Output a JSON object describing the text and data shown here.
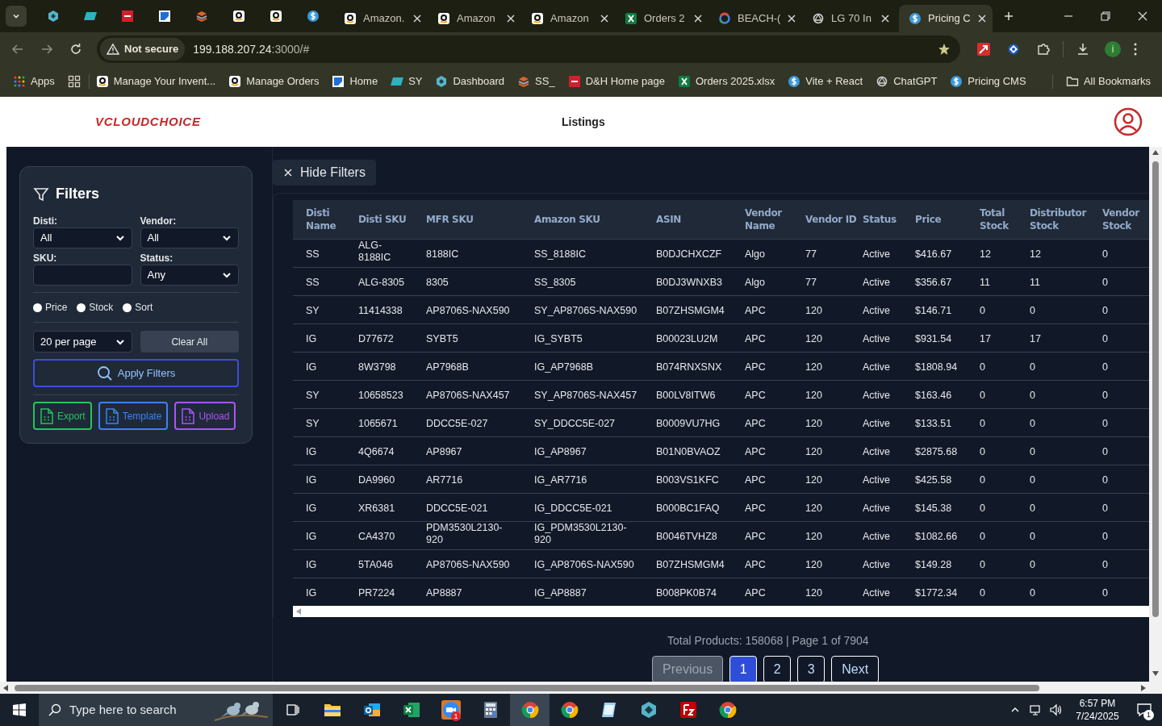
{
  "browser": {
    "pinned_tabs": [
      {
        "kind": "hexagon"
      },
      {
        "kind": "ec"
      },
      {
        "kind": "dh"
      },
      {
        "kind": "gblue"
      },
      {
        "kind": "stack"
      },
      {
        "kind": "amazon"
      },
      {
        "kind": "amazon"
      },
      {
        "kind": "dollar"
      }
    ],
    "tabs": [
      {
        "kind": "amazon",
        "title": "Amazon.",
        "selected": false
      },
      {
        "kind": "amazon",
        "title": "Amazon",
        "selected": false
      },
      {
        "kind": "amazon",
        "title": "Amazon",
        "selected": false
      },
      {
        "kind": "excel",
        "title": "Orders 2",
        "selected": false
      },
      {
        "kind": "google",
        "title": "BEACH-(",
        "selected": false
      },
      {
        "kind": "openai",
        "title": "LG 70 In",
        "selected": false
      },
      {
        "kind": "dollar",
        "title": "Pricing C",
        "selected": true
      }
    ],
    "security": "Not secure",
    "url_host": "199.188.207.24",
    "url_rest": ":3000/#",
    "profile_initial": "i",
    "bookmarks": [
      {
        "kind": "apps",
        "label": "Apps"
      },
      {
        "kind": "grid"
      },
      {
        "kind": "amazon",
        "label": "Manage Your Invent..."
      },
      {
        "kind": "amazon",
        "label": "Manage Orders"
      },
      {
        "kind": "gblue",
        "label": "Home"
      },
      {
        "kind": "ec",
        "label": "SY"
      },
      {
        "kind": "hexagon",
        "label": "Dashboard"
      },
      {
        "kind": "stack",
        "label": "SS_"
      },
      {
        "kind": "dh",
        "label": "D&H Home page"
      },
      {
        "kind": "excel",
        "label": "Orders 2025.xlsx"
      },
      {
        "kind": "dollar",
        "label": "Vite + React"
      },
      {
        "kind": "openai",
        "label": "ChatGPT"
      },
      {
        "kind": "dollar",
        "label": "Pricing CMS"
      }
    ],
    "all_bookmarks": "All Bookmarks"
  },
  "header": {
    "logo": "VCLOUDCHOICE",
    "title": "Listings"
  },
  "filters": {
    "title": "Filters",
    "fields": [
      {
        "kind": "select",
        "label": "Disti:",
        "value": "All"
      },
      {
        "kind": "select",
        "label": "Vendor:",
        "value": "All"
      },
      {
        "kind": "input",
        "label": "SKU:"
      },
      {
        "kind": "select",
        "label": "Status:",
        "value": "Any"
      }
    ],
    "radios": [
      {
        "label": "Price",
        "checked": false
      },
      {
        "label": "Stock",
        "checked": false
      },
      {
        "label": "Sort",
        "checked": false
      }
    ],
    "per_page": "20 per page",
    "clear": "Clear All",
    "apply": "Apply Filters",
    "actions": [
      {
        "label": "Export",
        "color": "#22c55e"
      },
      {
        "label": "Template",
        "color": "#3b82f6"
      },
      {
        "label": "Upload",
        "color": "#a855f7"
      }
    ]
  },
  "hide_filters": "Hide Filters",
  "table": {
    "columns": [
      "Disti Name",
      "Disti SKU",
      "MFR SKU",
      "Amazon SKU",
      "ASIN",
      "Vendor Name",
      "Vendor ID",
      "Status",
      "Price",
      "Total Stock",
      "Distributor Stock",
      "Vendor Stock"
    ],
    "rows": [
      [
        "SS",
        "ALG-8188IC",
        "8188IC",
        "SS_8188IC",
        "B0DJCHXCZF",
        "Algo",
        "77",
        "Active",
        "$416.67",
        "12",
        "12",
        "0"
      ],
      [
        "SS",
        "ALG-8305",
        "8305",
        "SS_8305",
        "B0DJ3WNXB3",
        "Algo",
        "77",
        "Active",
        "$356.67",
        "11",
        "11",
        "0"
      ],
      [
        "SY",
        "11414338",
        "AP8706S-NAX590",
        "SY_AP8706S-NAX590",
        "B07ZHSMGM4",
        "APC",
        "120",
        "Active",
        "$146.71",
        "0",
        "0",
        "0"
      ],
      [
        "IG",
        "D77672",
        "SYBT5",
        "IG_SYBT5",
        "B00023LU2M",
        "APC",
        "120",
        "Active",
        "$931.54",
        "17",
        "17",
        "0"
      ],
      [
        "IG",
        "8W3798",
        "AP7968B",
        "IG_AP7968B",
        "B074RNXSNX",
        "APC",
        "120",
        "Active",
        "$1808.94",
        "0",
        "0",
        "0"
      ],
      [
        "SY",
        "10658523",
        "AP8706S-NAX457",
        "SY_AP8706S-NAX457",
        "B00LV8ITW6",
        "APC",
        "120",
        "Active",
        "$163.46",
        "0",
        "0",
        "0"
      ],
      [
        "SY",
        "1065671",
        "DDCC5E-027",
        "SY_DDCC5E-027",
        "B0009VU7HG",
        "APC",
        "120",
        "Active",
        "$133.51",
        "0",
        "0",
        "0"
      ],
      [
        "IG",
        "4Q6674",
        "AP8967",
        "IG_AP8967",
        "B01N0BVAOZ",
        "APC",
        "120",
        "Active",
        "$2875.68",
        "0",
        "0",
        "0"
      ],
      [
        "IG",
        "DA9960",
        "AR7716",
        "IG_AR7716",
        "B003VS1KFC",
        "APC",
        "120",
        "Active",
        "$425.58",
        "0",
        "0",
        "0"
      ],
      [
        "IG",
        "XR6381",
        "DDCC5E-021",
        "IG_DDCC5E-021",
        "B000BC1FAQ",
        "APC",
        "120",
        "Active",
        "$145.38",
        "0",
        "0",
        "0"
      ],
      [
        "IG",
        "CA4370",
        "PDM3530L2130-920",
        "IG_PDM3530L2130-920",
        "B0046TVHZ8",
        "APC",
        "120",
        "Active",
        "$1082.66",
        "0",
        "0",
        "0"
      ],
      [
        "IG",
        "5TA046",
        "AP8706S-NAX590",
        "IG_AP8706S-NAX590",
        "B07ZHSMGM4",
        "APC",
        "120",
        "Active",
        "$149.28",
        "0",
        "0",
        "0"
      ],
      [
        "IG",
        "PR7224",
        "AP8887",
        "IG_AP8887",
        "B008PK0B74",
        "APC",
        "120",
        "Active",
        "$1772.34",
        "0",
        "0",
        "0"
      ]
    ]
  },
  "pagination": {
    "summary": "Total Products: 158068 | Page 1 of 7904",
    "previous": {
      "label": "Previous",
      "disabled": true
    },
    "pages": [
      {
        "label": "1",
        "selected": true
      },
      {
        "label": "2",
        "selected": false
      },
      {
        "label": "3",
        "selected": false
      }
    ],
    "next": {
      "label": "Next",
      "disabled": false
    }
  },
  "taskbar": {
    "search": "Type here to search",
    "apps": [
      {
        "kind": "taskview",
        "selected": false
      },
      {
        "kind": "folder",
        "selected": false
      },
      {
        "kind": "outlook",
        "selected": false
      },
      {
        "kind": "excel",
        "selected": false
      },
      {
        "kind": "zoom",
        "badge": "1",
        "selected": false
      },
      {
        "kind": "calculator",
        "selected": false
      },
      {
        "kind": "chrome",
        "selected": true
      },
      {
        "kind": "chrome",
        "selected": false
      },
      {
        "kind": "notes",
        "selected": false
      },
      {
        "kind": "hexagon",
        "selected": false
      },
      {
        "kind": "filezilla",
        "selected": false
      },
      {
        "kind": "chrome",
        "selected": false
      }
    ],
    "time": "6:57 PM",
    "date": "7/24/2025",
    "notifications": "1"
  }
}
